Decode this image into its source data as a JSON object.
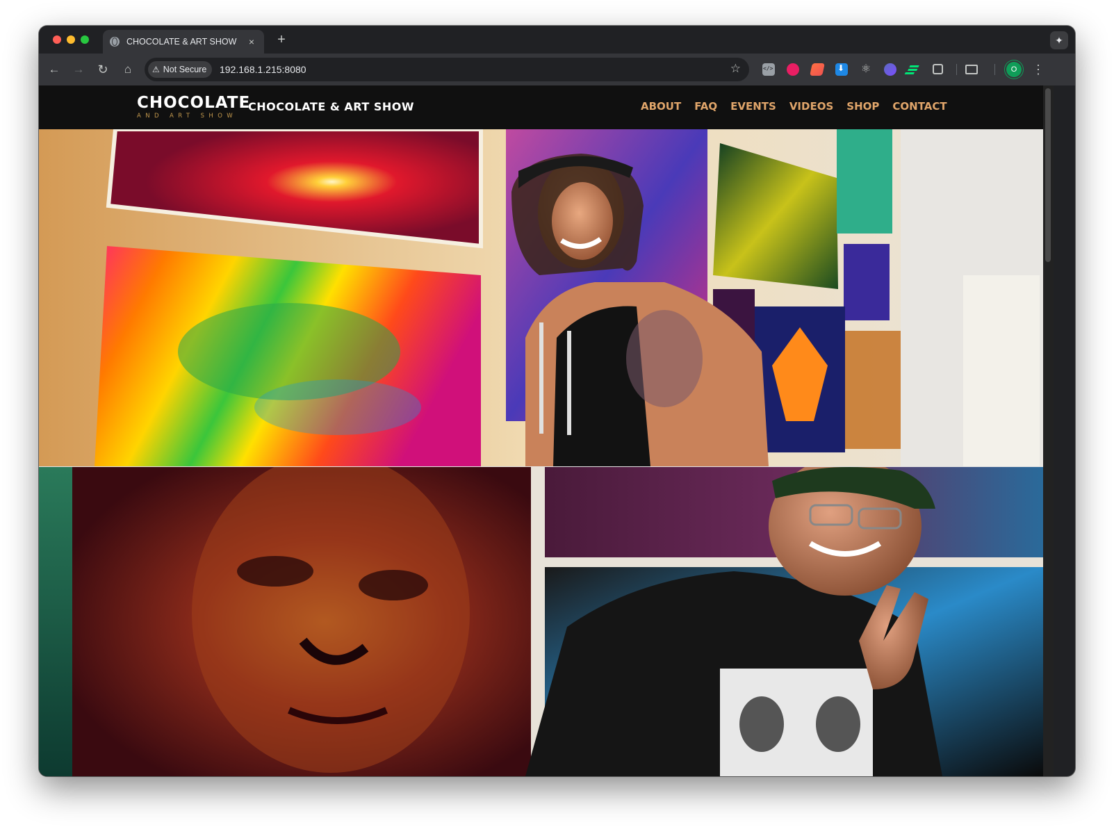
{
  "browser": {
    "tab_title": "CHOCOLATE & ART SHOW",
    "tab_close": "×",
    "new_tab": "+",
    "security_label": "Not Secure",
    "url": "192.168.1.215:8080",
    "profile_initial": "O",
    "nav": {
      "back": "←",
      "forward": "→",
      "reload": "↻",
      "home": "⌂"
    },
    "icons": {
      "star": "☆",
      "menu": "⋮",
      "assistant": "✦",
      "warning": "⚠"
    }
  },
  "site": {
    "logo_main": "CHOCOLATE",
    "logo_sub": "AND ART SHOW",
    "title": "CHOCOLATE & ART SHOW",
    "nav": [
      "ABOUT",
      "FAQ",
      "EVENTS",
      "VIDEOS",
      "SHOP",
      "CONTACT"
    ]
  },
  "colors": {
    "nav_accent": "#e0a56a",
    "logo_sub": "#c59a4e",
    "header_bg": "#101010"
  }
}
